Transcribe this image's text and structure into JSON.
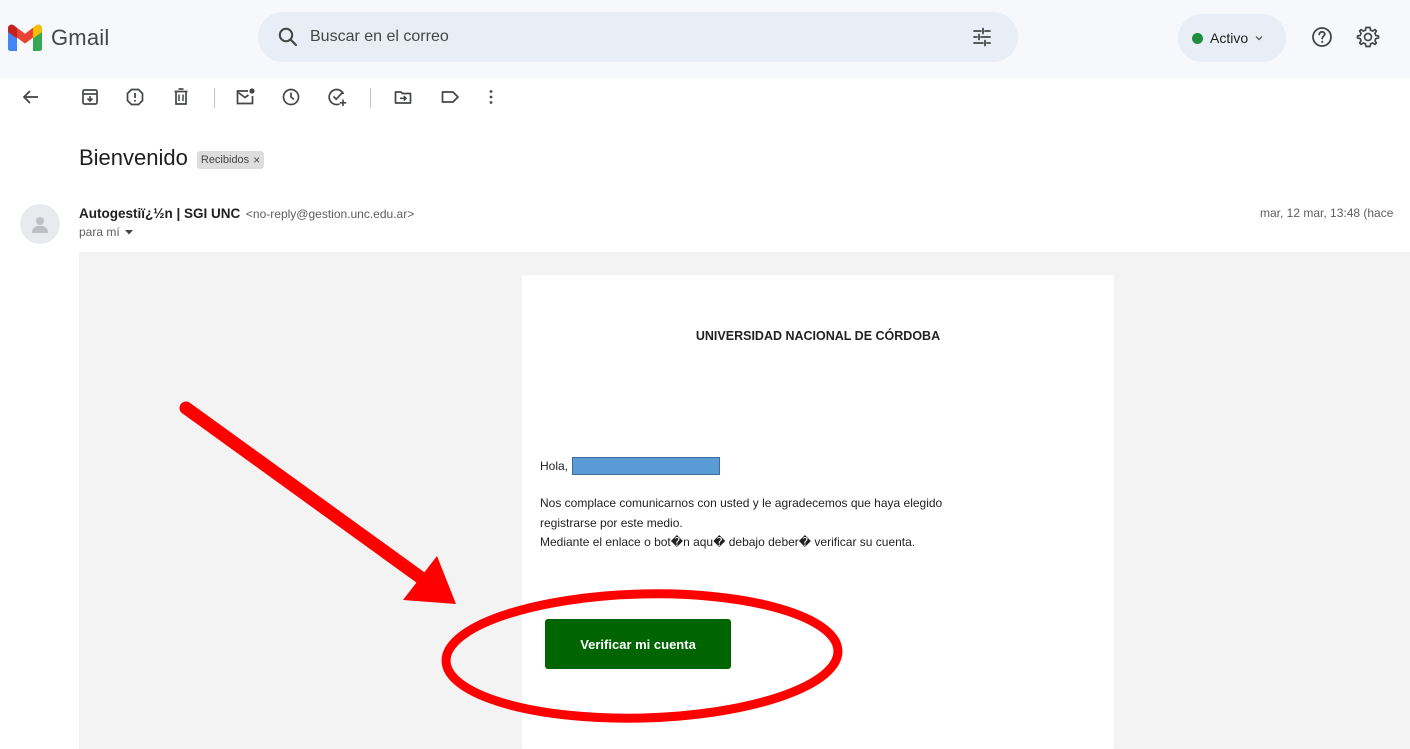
{
  "app": {
    "name": "Gmail"
  },
  "search": {
    "placeholder": "Buscar en el correo"
  },
  "status": {
    "label": "Activo"
  },
  "message": {
    "subject": "Bienvenido",
    "label_chip": "Recibidos",
    "label_remove": "×",
    "sender_name": "Autogestiï¿½n | SGI UNC",
    "sender_email": "<no-reply@gestion.unc.edu.ar>",
    "recipient": "para mí",
    "date": "mar, 12 mar, 13:48 (hace"
  },
  "email_body": {
    "university": "UNIVERSIDAD NACIONAL DE CÓRDOBA",
    "greeting": "Hola,",
    "paragraph_line1": "Nos complace comunicarnos con usted y le agradecemos que haya elegido",
    "paragraph_line2": "registrarse por este medio.",
    "paragraph_line3": "Mediante el enlace o bot�n aqu� debajo deber� verificar su cuenta.",
    "button_label": "Verificar mi cuenta"
  },
  "colors": {
    "button": "#006400",
    "annotation": "#ff0000",
    "redaction": "#5b9bd5",
    "status_dot": "#1e8e3e"
  },
  "icons": {
    "toolbar": [
      "back-arrow-icon",
      "archive-icon",
      "report-spam-icon",
      "delete-icon",
      "mark-unread-icon",
      "snooze-icon",
      "add-task-icon",
      "move-to-icon",
      "label-icon",
      "more-vert-icon"
    ]
  }
}
